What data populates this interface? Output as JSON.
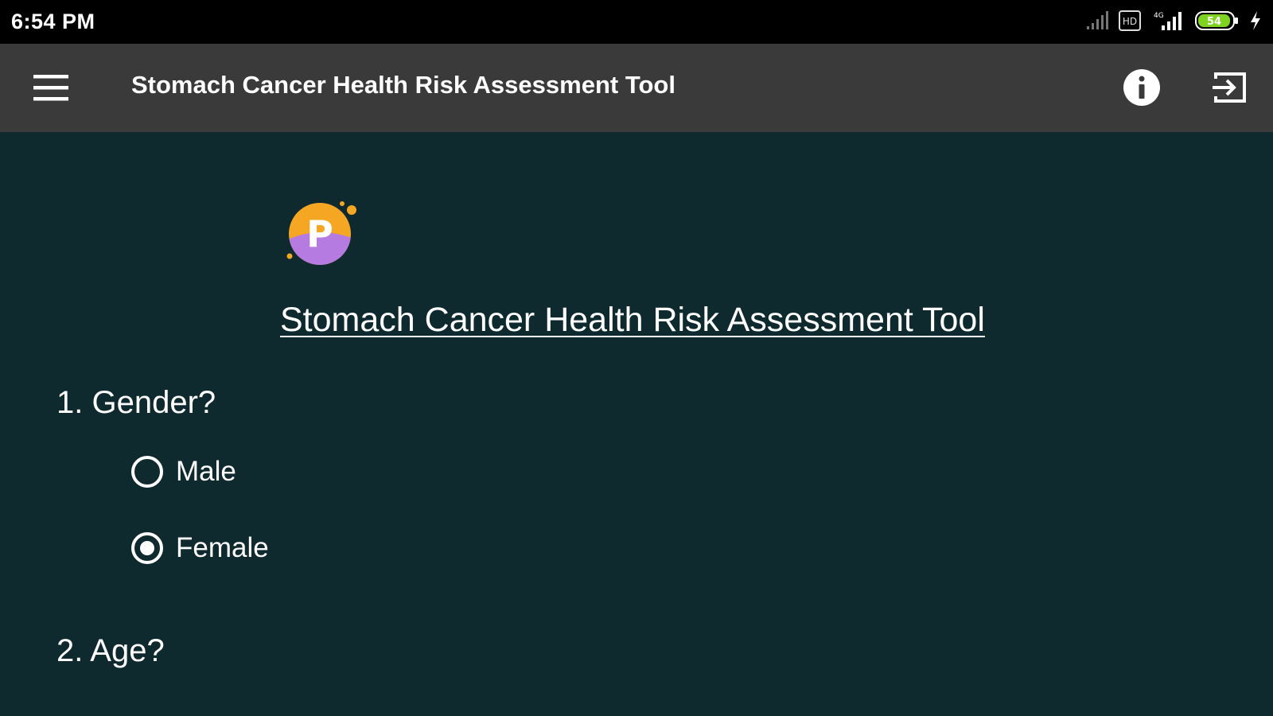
{
  "status_bar": {
    "time": "6:54 PM",
    "network_label": "4G",
    "battery_level": "54",
    "icons": [
      "weak-signal-icon",
      "hd-icon",
      "cell-signal-icon",
      "battery-icon",
      "charging-bolt-icon"
    ]
  },
  "app_bar": {
    "title": "Stomach Cancer Health Risk Assessment Tool",
    "icons": [
      "hamburger-menu-icon",
      "info-icon",
      "exit-icon"
    ]
  },
  "main": {
    "logo_letter": "P",
    "heading": "Stomach Cancer Health Risk Assessment Tool",
    "questions": [
      {
        "label": "1. Gender?",
        "options": [
          {
            "label": "Male",
            "selected": false
          },
          {
            "label": "Female",
            "selected": true
          }
        ]
      },
      {
        "label": "2. Age?"
      }
    ]
  },
  "colors": {
    "status_bar_bg": "#000000",
    "app_bar_bg": "#3a3a3a",
    "page_bg": "#0e2a2e",
    "logo_orange": "#f5a623",
    "logo_purple": "#b57be0",
    "battery_fill": "#7ed321"
  }
}
